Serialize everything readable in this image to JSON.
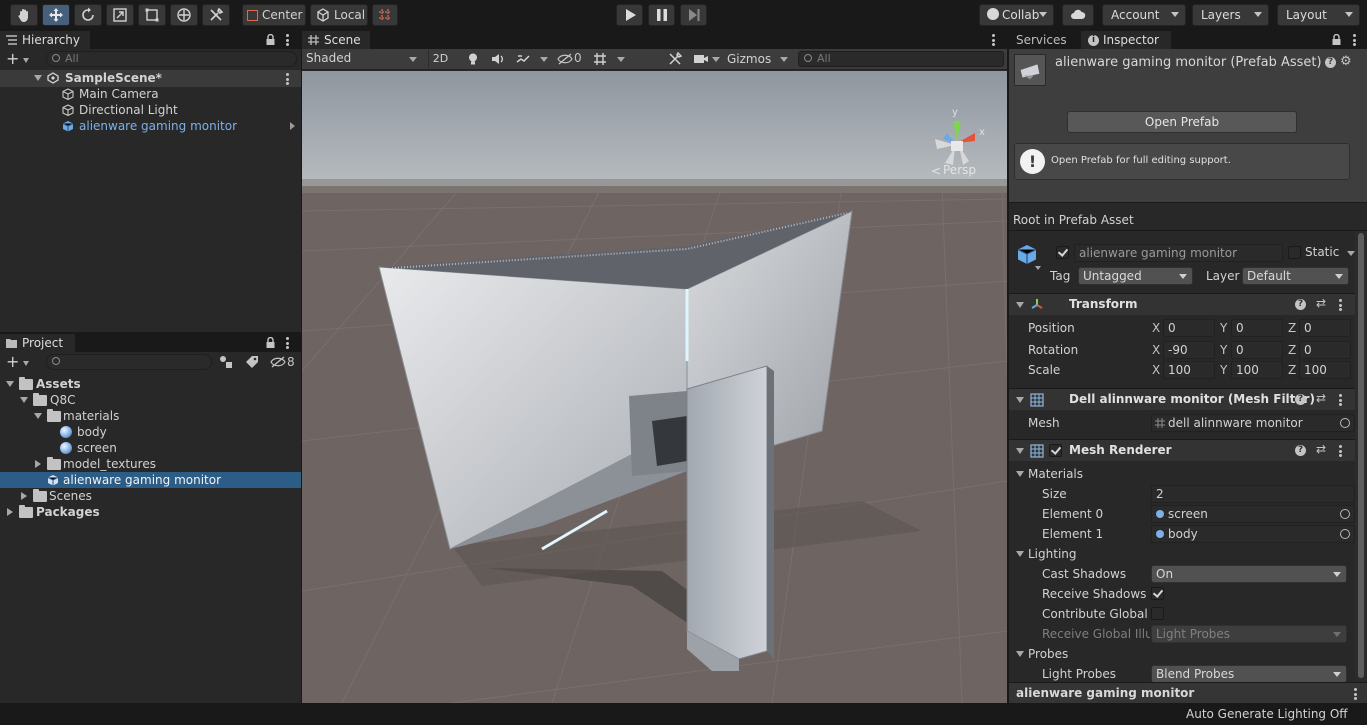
{
  "toolbar": {
    "pivot_label": "Center",
    "space_label": "Local",
    "collab_label": "Collab",
    "account_label": "Account",
    "layers_label": "Layers",
    "layout_label": "Layout"
  },
  "hierarchy": {
    "tab_label": "Hierarchy",
    "search_placeholder": "All",
    "scene_name": "SampleScene*",
    "items": [
      "Main Camera",
      "Directional Light",
      "alienware gaming monitor"
    ]
  },
  "project": {
    "tab_label": "Project",
    "hidden_count": "8",
    "tree": {
      "assets": "Assets",
      "q8c": "Q8C",
      "materials": "materials",
      "body": "body",
      "screen": "screen",
      "model_textures": "model_textures",
      "prefab": "alienware gaming monitor",
      "scenes": "Scenes",
      "packages": "Packages"
    }
  },
  "scene": {
    "tab_label": "Scene",
    "shading_mode": "Shaded",
    "mode_2d": "2D",
    "hidden_count": "0",
    "gizmos_label": "Gizmos",
    "search_placeholder": "All",
    "projection_label": "Persp",
    "axis_x": "x",
    "axis_y": "y"
  },
  "inspector": {
    "services_tab": "Services",
    "inspector_tab": "Inspector",
    "asset_title": "alienware gaming monitor (Prefab Asset)",
    "open_prefab_button": "Open Prefab",
    "help_text": "Open Prefab for full editing support.",
    "root_label": "Root in Prefab Asset",
    "object_name": "alienware gaming monitor",
    "static_label": "Static",
    "tag_label": "Tag",
    "tag_value": "Untagged",
    "layer_label": "Layer",
    "layer_value": "Default",
    "transform": {
      "title": "Transform",
      "position_label": "Position",
      "rotation_label": "Rotation",
      "scale_label": "Scale",
      "x": "X",
      "y": "Y",
      "z": "Z",
      "position": [
        "0",
        "0",
        "0"
      ],
      "rotation": [
        "-90",
        "0",
        "0"
      ],
      "scale": [
        "100",
        "100",
        "100"
      ]
    },
    "mesh_filter": {
      "title": "Dell  alinnware monitor (Mesh Filter)",
      "mesh_label": "Mesh",
      "mesh_value": "dell  alinnware monitor"
    },
    "mesh_renderer": {
      "title": "Mesh Renderer",
      "materials_label": "Materials",
      "size_label": "Size",
      "size_value": "2",
      "element0_label": "Element 0",
      "element0_value": "screen",
      "element1_label": "Element 1",
      "element1_value": "body",
      "lighting_label": "Lighting",
      "cast_shadows_label": "Cast Shadows",
      "cast_shadows_value": "On",
      "receive_shadows_label": "Receive Shadows",
      "contribute_gi_label": "Contribute Global Il",
      "receive_gi_label": "Receive Global Illui",
      "receive_gi_value": "Light Probes",
      "probes_label": "Probes",
      "light_probes_label": "Light Probes",
      "light_probes_value": "Blend Probes"
    },
    "footer_name": "alienware gaming monitor"
  },
  "status_bar": {
    "lighting_text": "Auto Generate Lighting Off"
  },
  "colors": {
    "selection": "#2c5d87",
    "accent_blue": "#7bb0e8",
    "panel": "#282828",
    "sky": "#9aa3ad",
    "ground": "#6e6562"
  }
}
